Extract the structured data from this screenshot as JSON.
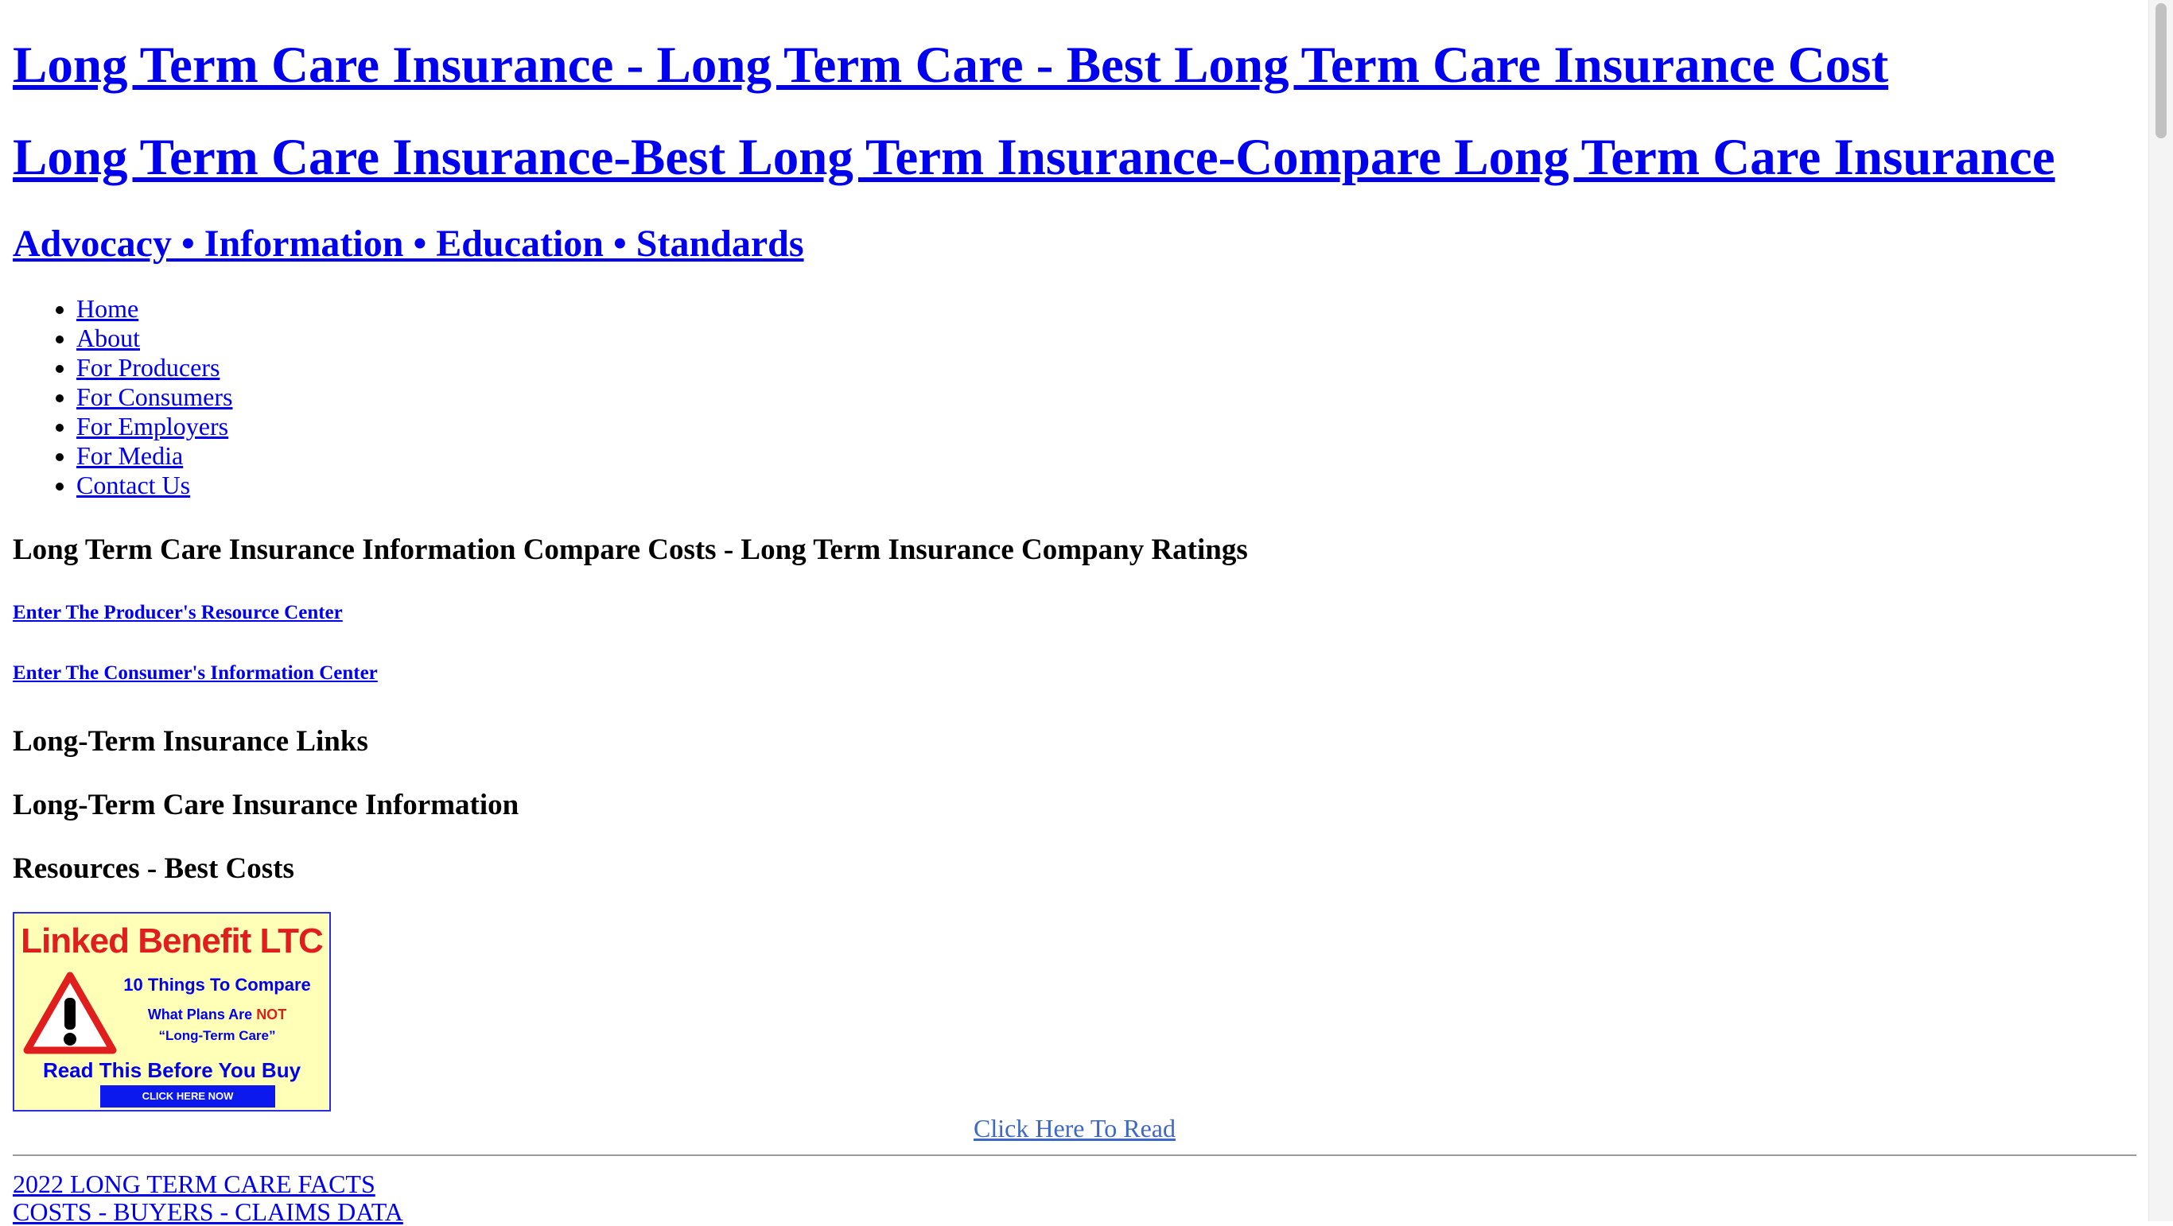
{
  "header": {
    "title1": "Long Term Care Insurance - Long Term Care - Best Long Term Care Insurance Cost",
    "title2": "Long Term Care Insurance-Best Long Term Insurance-Compare Long Term Care Insurance",
    "tagline": "Advocacy • Information • Education • Standards"
  },
  "nav": {
    "items": [
      {
        "label": "Home"
      },
      {
        "label": "About"
      },
      {
        "label": "For Producers"
      },
      {
        "label": "For Consumers"
      },
      {
        "label": "For Employers"
      },
      {
        "label": "For Media"
      },
      {
        "label": "Contact Us"
      }
    ]
  },
  "main": {
    "info_heading": "Long Term Care Insurance Information Compare Costs - Long Term Insurance Company Ratings",
    "producer_link": "Enter The Producer's Resource Center",
    "consumer_link": "Enter The Consumer's Information Center",
    "links_heading": "Long-Term Insurance Links",
    "info_heading2": "Long-Term Care Insurance Information",
    "resources_heading": "Resources - Best Costs"
  },
  "banner": {
    "title": "Linked Benefit LTC",
    "line1": "10 Things To Compare",
    "line2_prefix": "What Plans Are ",
    "line2_highlight": "NOT",
    "line3": "“Long-Term Care”",
    "line4": "Read This Before You Buy",
    "cta": "CLICK HERE NOW",
    "icon": "warning-triangle-icon",
    "colors": {
      "background": "#ffffb8",
      "title": "#e01e1e",
      "cta_bg": "#0b18ee",
      "border": "#2a2ee0"
    }
  },
  "read_link": "Click Here To Read",
  "facts": {
    "line1": "2022 LONG TERM CARE FACTS",
    "line2": "COSTS - BUYERS - CLAIMS DATA"
  },
  "colors": {
    "link": "#0000ee",
    "read_link": "#3d68c9"
  }
}
